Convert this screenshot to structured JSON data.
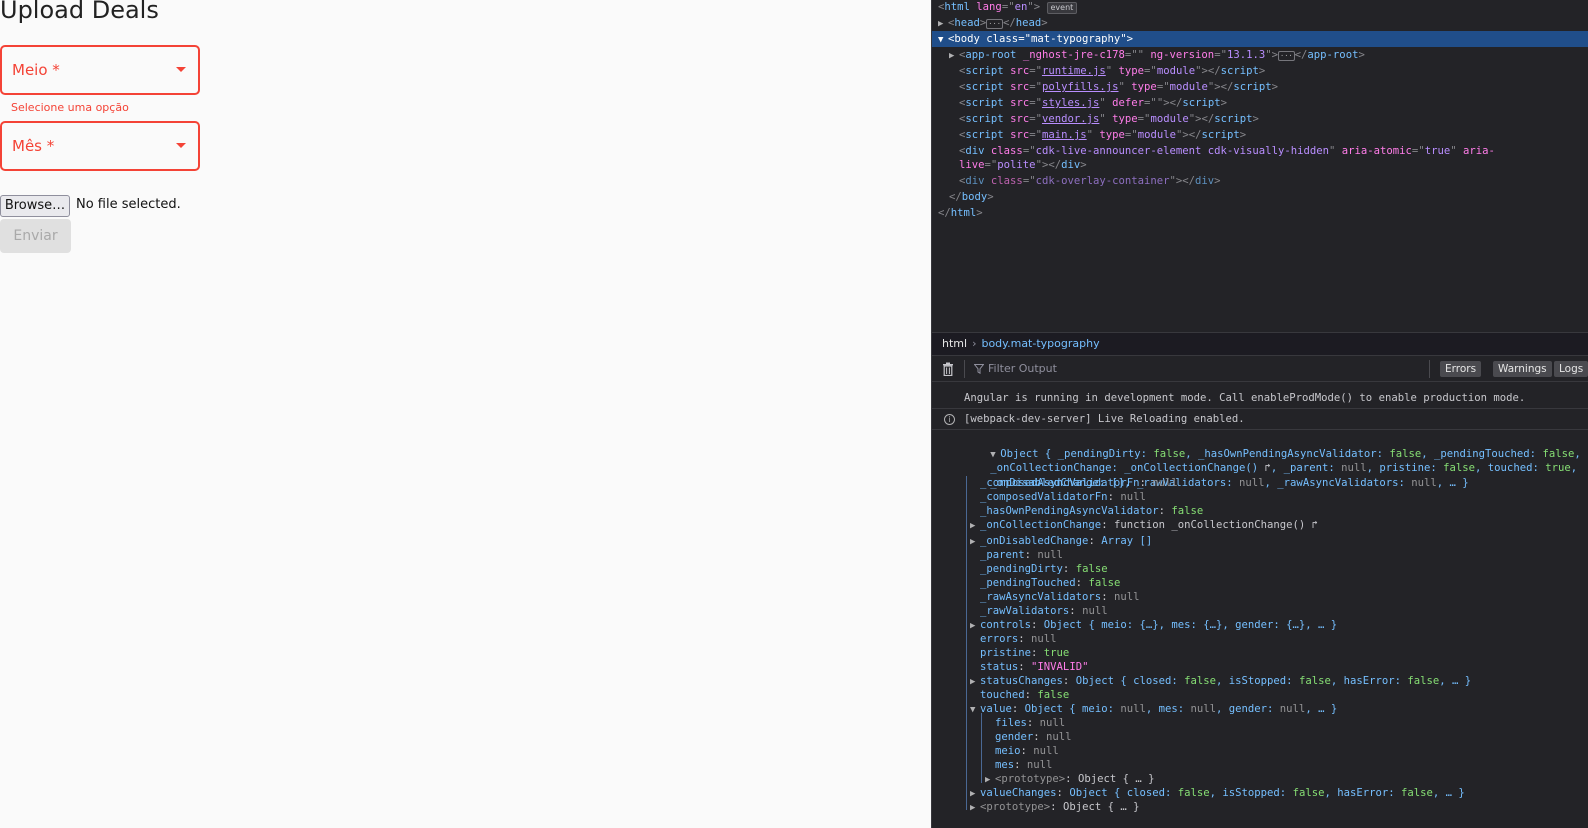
{
  "page": {
    "title": "Upload Deals",
    "fields": [
      {
        "label": "Meio *"
      },
      {
        "label": "Mês *"
      }
    ],
    "error_hint": "Selecione uma opção",
    "browse_label": "Browse…",
    "file_status": "No file selected.",
    "submit_label": "Enviar"
  },
  "devtools": {
    "markup": {
      "html_open_tag": "html",
      "html_lang_attr": "lang",
      "html_lang_val": "en",
      "event_badge": "event",
      "head_tag": "head",
      "body_tag": "body",
      "body_class_attr": "class",
      "body_class_val": "mat-typography",
      "approot_tag": "app-root",
      "approot_attr1": "_nghost-jre-c178",
      "approot_attr2": "ng-version",
      "approot_ver": "13.1.3",
      "scripts": [
        {
          "src": "runtime.js",
          "attr": "type",
          "val": "module"
        },
        {
          "src": "polyfills.js",
          "attr": "type",
          "val": "module"
        },
        {
          "src": "styles.js",
          "attr": "defer",
          "val": ""
        },
        {
          "src": "vendor.js",
          "attr": "type",
          "val": "module"
        },
        {
          "src": "main.js",
          "attr": "type",
          "val": "module"
        }
      ],
      "announcer_class": "cdk-live-announcer-element cdk-visually-hidden",
      "announcer_attr1": "aria-atomic",
      "announcer_val1": "true",
      "announcer_attr2a": "aria-",
      "announcer_attr2b": "live",
      "announcer_val2": "polite",
      "overlay_class": "cdk-overlay-container"
    },
    "breadcrumb": {
      "root": "html",
      "current": "body.mat-typography"
    },
    "console_toolbar": {
      "filter_placeholder": "Filter Output",
      "buttons": [
        "Errors",
        "Warnings",
        "Logs"
      ]
    },
    "messages": {
      "angular": "Angular is running in development mode. Call enableProdMode() to enable production mode.",
      "wds": "[webpack-dev-server] Live Reloading enabled."
    },
    "obj_summary": {
      "line1_a": "Object { _pendingDirty: ",
      "line1_b": "false",
      "line1_c": ", _hasOwnPendingAsyncValidator: ",
      "line1_d": "false",
      "line1_e": ", _pendingTouched: ",
      "line1_f": "false",
      "line1_g": ",",
      "line2_a": "_onCollectionChange: ",
      "line2_b": "_onCollectionChange()",
      "line2_c": ", _parent: ",
      "line2_d": "null",
      "line2_e": ", pristine: ",
      "line2_f": "false",
      "line2_g": ", touched: ",
      "line2_h": "true",
      "line2_i": ",",
      "line3_a": "_onDisabledChange: [], _rawValidators: ",
      "line3_b": "null",
      "line3_c": ", _rawAsyncValidators: ",
      "line3_d": "null",
      "line3_e": ", … }"
    },
    "props": {
      "composedAsync": {
        "k": "_composedAsyncValidatorFn",
        "v": "null"
      },
      "composedValidator": {
        "k": "_composedValidatorFn",
        "v": "null"
      },
      "hasOwnPending": {
        "k": "_hasOwnPendingAsyncValidator",
        "v": "false"
      },
      "onCollectionChange": {
        "k": "_onCollectionChange",
        "v": "function _onCollectionChange()"
      },
      "onDisabledChange": {
        "k": "_onDisabledChange",
        "v": "Array []"
      },
      "parent": {
        "k": "_parent",
        "v": "null"
      },
      "pendingDirty": {
        "k": "_pendingDirty",
        "v": "false"
      },
      "pendingTouched": {
        "k": "_pendingTouched",
        "v": "false"
      },
      "rawAsync": {
        "k": "_rawAsyncValidators",
        "v": "null"
      },
      "rawValidators": {
        "k": "_rawValidators",
        "v": "null"
      },
      "controls": {
        "k": "controls",
        "v": "Object { meio: {…}, mes: {…}, gender: {…}, … }"
      },
      "errors": {
        "k": "errors",
        "v": "null"
      },
      "pristine": {
        "k": "pristine",
        "v": "true"
      },
      "status": {
        "k": "status",
        "v": "\"INVALID\""
      },
      "statusChanges": {
        "k": "statusChanges",
        "v1": "Object { closed: ",
        "v2": "false",
        "v3": ", isStopped: ",
        "v4": "false",
        "v5": ", hasError: ",
        "v6": "false",
        "v7": ", … }"
      },
      "touched": {
        "k": "touched",
        "v": "false"
      },
      "value": {
        "k": "value",
        "v1": "Object { meio: ",
        "v2": "null",
        "v3": ", mes: ",
        "v4": "null",
        "v5": ", gender: ",
        "v6": "null",
        "v7": ", … }"
      },
      "files": {
        "k": "files",
        "v": "null"
      },
      "gender": {
        "k": "gender",
        "v": "null"
      },
      "meio": {
        "k": "meio",
        "v": "null"
      },
      "mes": {
        "k": "mes",
        "v": "null"
      },
      "proto_inner": {
        "k": "<prototype>",
        "v": "Object { … }"
      },
      "valueChanges": {
        "k": "valueChanges",
        "v1": "Object { closed: ",
        "v2": "false",
        "v3": ", isStopped: ",
        "v4": "false",
        "v5": ", hasError: ",
        "v6": "false",
        "v7": ", … }"
      },
      "proto_outer": {
        "k": "<prototype>",
        "v": "Object { … }"
      }
    }
  }
}
